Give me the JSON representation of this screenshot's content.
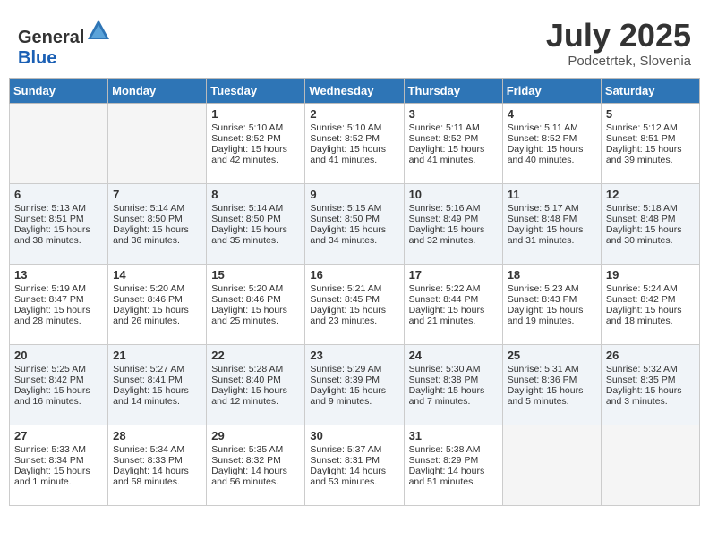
{
  "header": {
    "logo_general": "General",
    "logo_blue": "Blue",
    "month_title": "July 2025",
    "location": "Podcetrtek, Slovenia"
  },
  "days_of_week": [
    "Sunday",
    "Monday",
    "Tuesday",
    "Wednesday",
    "Thursday",
    "Friday",
    "Saturday"
  ],
  "weeks": [
    [
      {
        "day": "",
        "empty": true
      },
      {
        "day": "",
        "empty": true
      },
      {
        "day": "1",
        "sunrise": "Sunrise: 5:10 AM",
        "sunset": "Sunset: 8:52 PM",
        "daylight": "Daylight: 15 hours and 42 minutes."
      },
      {
        "day": "2",
        "sunrise": "Sunrise: 5:10 AM",
        "sunset": "Sunset: 8:52 PM",
        "daylight": "Daylight: 15 hours and 41 minutes."
      },
      {
        "day": "3",
        "sunrise": "Sunrise: 5:11 AM",
        "sunset": "Sunset: 8:52 PM",
        "daylight": "Daylight: 15 hours and 41 minutes."
      },
      {
        "day": "4",
        "sunrise": "Sunrise: 5:11 AM",
        "sunset": "Sunset: 8:52 PM",
        "daylight": "Daylight: 15 hours and 40 minutes."
      },
      {
        "day": "5",
        "sunrise": "Sunrise: 5:12 AM",
        "sunset": "Sunset: 8:51 PM",
        "daylight": "Daylight: 15 hours and 39 minutes."
      }
    ],
    [
      {
        "day": "6",
        "sunrise": "Sunrise: 5:13 AM",
        "sunset": "Sunset: 8:51 PM",
        "daylight": "Daylight: 15 hours and 38 minutes."
      },
      {
        "day": "7",
        "sunrise": "Sunrise: 5:14 AM",
        "sunset": "Sunset: 8:50 PM",
        "daylight": "Daylight: 15 hours and 36 minutes."
      },
      {
        "day": "8",
        "sunrise": "Sunrise: 5:14 AM",
        "sunset": "Sunset: 8:50 PM",
        "daylight": "Daylight: 15 hours and 35 minutes."
      },
      {
        "day": "9",
        "sunrise": "Sunrise: 5:15 AM",
        "sunset": "Sunset: 8:50 PM",
        "daylight": "Daylight: 15 hours and 34 minutes."
      },
      {
        "day": "10",
        "sunrise": "Sunrise: 5:16 AM",
        "sunset": "Sunset: 8:49 PM",
        "daylight": "Daylight: 15 hours and 32 minutes."
      },
      {
        "day": "11",
        "sunrise": "Sunrise: 5:17 AM",
        "sunset": "Sunset: 8:48 PM",
        "daylight": "Daylight: 15 hours and 31 minutes."
      },
      {
        "day": "12",
        "sunrise": "Sunrise: 5:18 AM",
        "sunset": "Sunset: 8:48 PM",
        "daylight": "Daylight: 15 hours and 30 minutes."
      }
    ],
    [
      {
        "day": "13",
        "sunrise": "Sunrise: 5:19 AM",
        "sunset": "Sunset: 8:47 PM",
        "daylight": "Daylight: 15 hours and 28 minutes."
      },
      {
        "day": "14",
        "sunrise": "Sunrise: 5:20 AM",
        "sunset": "Sunset: 8:46 PM",
        "daylight": "Daylight: 15 hours and 26 minutes."
      },
      {
        "day": "15",
        "sunrise": "Sunrise: 5:20 AM",
        "sunset": "Sunset: 8:46 PM",
        "daylight": "Daylight: 15 hours and 25 minutes."
      },
      {
        "day": "16",
        "sunrise": "Sunrise: 5:21 AM",
        "sunset": "Sunset: 8:45 PM",
        "daylight": "Daylight: 15 hours and 23 minutes."
      },
      {
        "day": "17",
        "sunrise": "Sunrise: 5:22 AM",
        "sunset": "Sunset: 8:44 PM",
        "daylight": "Daylight: 15 hours and 21 minutes."
      },
      {
        "day": "18",
        "sunrise": "Sunrise: 5:23 AM",
        "sunset": "Sunset: 8:43 PM",
        "daylight": "Daylight: 15 hours and 19 minutes."
      },
      {
        "day": "19",
        "sunrise": "Sunrise: 5:24 AM",
        "sunset": "Sunset: 8:42 PM",
        "daylight": "Daylight: 15 hours and 18 minutes."
      }
    ],
    [
      {
        "day": "20",
        "sunrise": "Sunrise: 5:25 AM",
        "sunset": "Sunset: 8:42 PM",
        "daylight": "Daylight: 15 hours and 16 minutes."
      },
      {
        "day": "21",
        "sunrise": "Sunrise: 5:27 AM",
        "sunset": "Sunset: 8:41 PM",
        "daylight": "Daylight: 15 hours and 14 minutes."
      },
      {
        "day": "22",
        "sunrise": "Sunrise: 5:28 AM",
        "sunset": "Sunset: 8:40 PM",
        "daylight": "Daylight: 15 hours and 12 minutes."
      },
      {
        "day": "23",
        "sunrise": "Sunrise: 5:29 AM",
        "sunset": "Sunset: 8:39 PM",
        "daylight": "Daylight: 15 hours and 9 minutes."
      },
      {
        "day": "24",
        "sunrise": "Sunrise: 5:30 AM",
        "sunset": "Sunset: 8:38 PM",
        "daylight": "Daylight: 15 hours and 7 minutes."
      },
      {
        "day": "25",
        "sunrise": "Sunrise: 5:31 AM",
        "sunset": "Sunset: 8:36 PM",
        "daylight": "Daylight: 15 hours and 5 minutes."
      },
      {
        "day": "26",
        "sunrise": "Sunrise: 5:32 AM",
        "sunset": "Sunset: 8:35 PM",
        "daylight": "Daylight: 15 hours and 3 minutes."
      }
    ],
    [
      {
        "day": "27",
        "sunrise": "Sunrise: 5:33 AM",
        "sunset": "Sunset: 8:34 PM",
        "daylight": "Daylight: 15 hours and 1 minute."
      },
      {
        "day": "28",
        "sunrise": "Sunrise: 5:34 AM",
        "sunset": "Sunset: 8:33 PM",
        "daylight": "Daylight: 14 hours and 58 minutes."
      },
      {
        "day": "29",
        "sunrise": "Sunrise: 5:35 AM",
        "sunset": "Sunset: 8:32 PM",
        "daylight": "Daylight: 14 hours and 56 minutes."
      },
      {
        "day": "30",
        "sunrise": "Sunrise: 5:37 AM",
        "sunset": "Sunset: 8:31 PM",
        "daylight": "Daylight: 14 hours and 53 minutes."
      },
      {
        "day": "31",
        "sunrise": "Sunrise: 5:38 AM",
        "sunset": "Sunset: 8:29 PM",
        "daylight": "Daylight: 14 hours and 51 minutes."
      },
      {
        "day": "",
        "empty": true
      },
      {
        "day": "",
        "empty": true
      }
    ]
  ]
}
